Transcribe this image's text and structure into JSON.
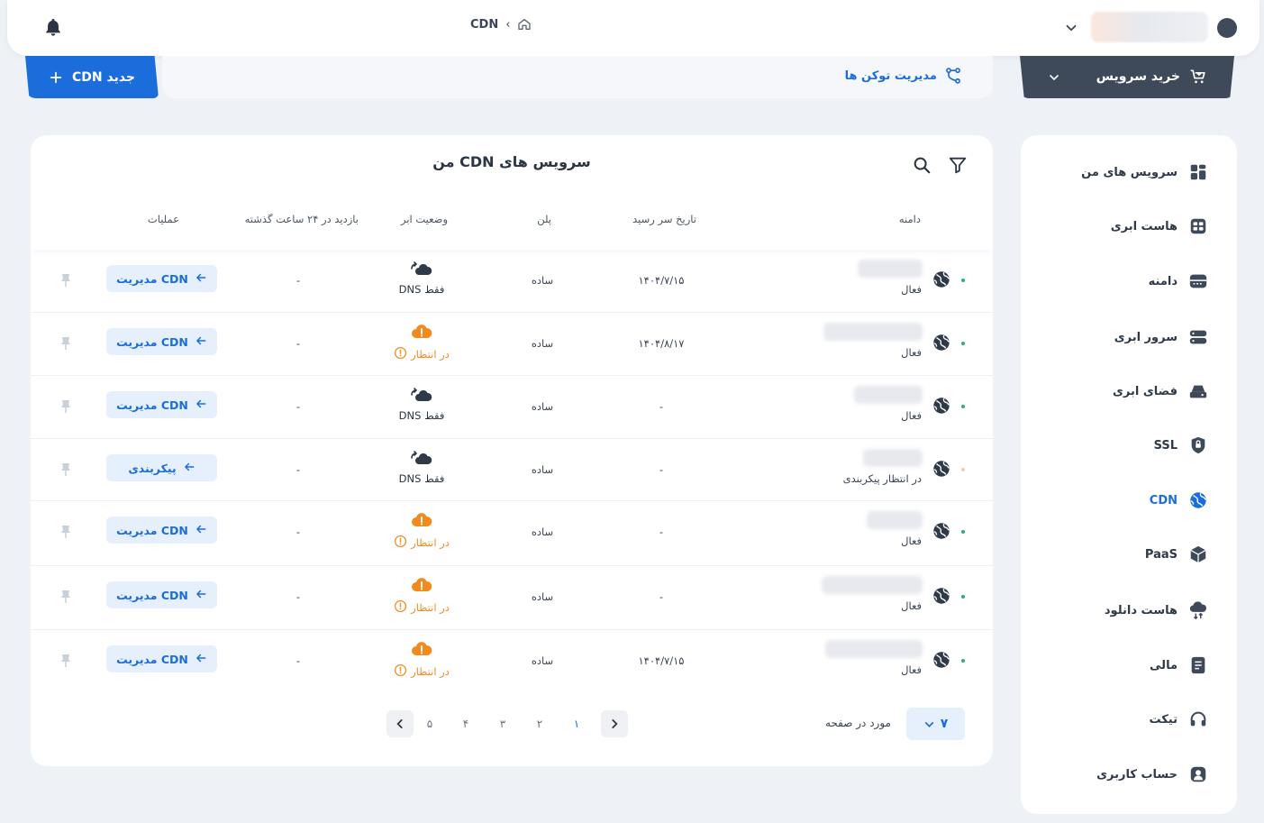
{
  "breadcrumb": {
    "current": "CDN",
    "separator": "‹"
  },
  "topbar": {
    "home_icon": "home-icon",
    "bell_icon": "bell-icon"
  },
  "actions": {
    "new_cdn": "CDN جدید",
    "token_management": "مدیریت توکن ها",
    "buy_service": "خرید سرویس"
  },
  "sidebar": {
    "items": [
      {
        "label": "سرویس های من",
        "icon": "grid-icon"
      },
      {
        "label": "هاست ابری",
        "icon": "cloud-host-icon"
      },
      {
        "label": "دامنه",
        "icon": "domain-icon"
      },
      {
        "label": "سرور ابری",
        "icon": "server-icon"
      },
      {
        "label": "فضای ابری",
        "icon": "cloud-storage-icon"
      },
      {
        "label": "SSL",
        "icon": "ssl-icon"
      },
      {
        "label": "CDN",
        "icon": "globe-icon",
        "active": true
      },
      {
        "label": "PaaS",
        "icon": "cube-icon"
      },
      {
        "label": "هاست دانلود",
        "icon": "download-host-icon"
      },
      {
        "label": "مالی",
        "icon": "finance-icon"
      },
      {
        "label": "تیکت",
        "icon": "headset-icon"
      },
      {
        "label": "حساب کاربری",
        "icon": "user-icon"
      }
    ]
  },
  "table": {
    "title": "سرویس های CDN من",
    "headers": {
      "domain": "دامنه",
      "expiry": "تاریخ سر رسید",
      "plan": "پلن",
      "cloud_status": "وضعیت ابر",
      "visits": "بازدید در ۲۴ ساعت گذشته",
      "operations": "عملیات"
    },
    "rows": [
      {
        "status": "فعال",
        "expiry": "۱۴۰۴/۷/۱۵",
        "plan": "ساده",
        "cloud": "فقط DNS",
        "cloud_kind": "dns",
        "visits": "-",
        "action": "مدیریت CDN"
      },
      {
        "status": "فعال",
        "expiry": "۱۴۰۴/۸/۱۷",
        "plan": "ساده",
        "cloud": "در انتظار",
        "cloud_kind": "pending",
        "visits": "-",
        "action": "مدیریت CDN"
      },
      {
        "status": "فعال",
        "expiry": "-",
        "plan": "ساده",
        "cloud": "فقط DNS",
        "cloud_kind": "dns",
        "visits": "-",
        "action": "مدیریت CDN"
      },
      {
        "status": "در انتظار پیکربندی",
        "expiry": "-",
        "plan": "ساده",
        "cloud": "فقط DNS",
        "cloud_kind": "dns",
        "visits": "-",
        "action": "پیکربندی"
      },
      {
        "status": "فعال",
        "expiry": "-",
        "plan": "ساده",
        "cloud": "در انتظار",
        "cloud_kind": "pending",
        "visits": "-",
        "action": "مدیریت CDN"
      },
      {
        "status": "فعال",
        "expiry": "-",
        "plan": "ساده",
        "cloud": "در انتظار",
        "cloud_kind": "pending",
        "visits": "-",
        "action": "مدیریت CDN"
      },
      {
        "status": "فعال",
        "expiry": "۱۴۰۴/۷/۱۵",
        "plan": "ساده",
        "cloud": "در انتظار",
        "cloud_kind": "pending",
        "visits": "-",
        "action": "مدیریت CDN"
      }
    ]
  },
  "pagination": {
    "pages": [
      "۱",
      "۲",
      "۳",
      "۴",
      "۵"
    ],
    "current": "۱",
    "per_page_label": "مورد در صفحه",
    "per_page_value": "۷"
  },
  "colors": {
    "accent": "#1a6ddb",
    "dark": "#3e4a5a",
    "pending": "#f28a1e",
    "active_dot": "#1db38a"
  }
}
